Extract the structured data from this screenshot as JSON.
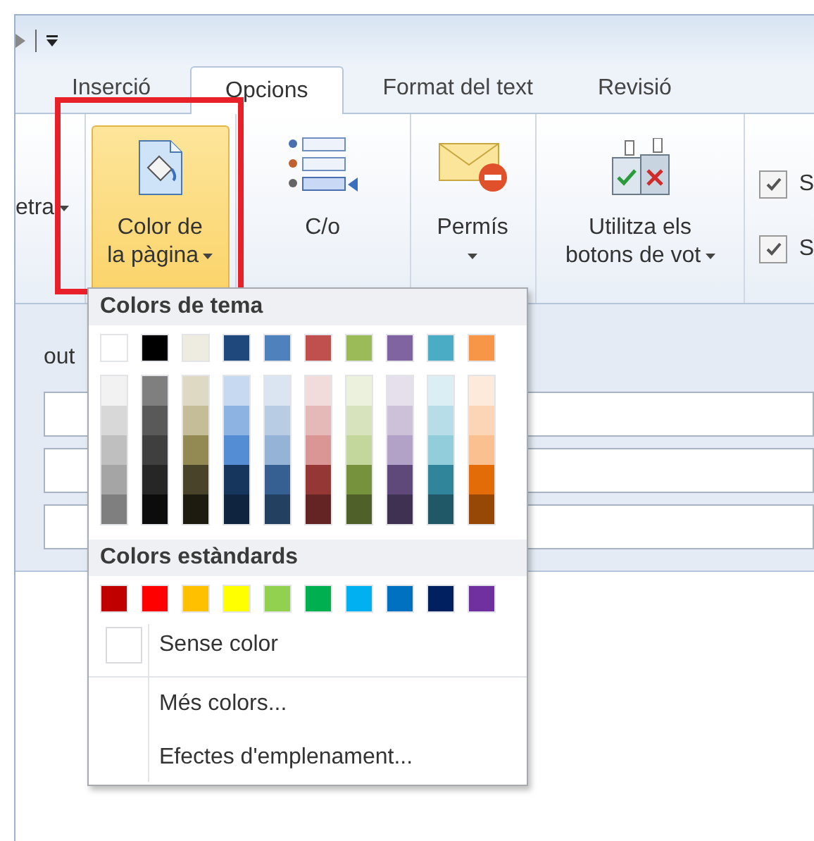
{
  "tabs": [
    {
      "label": "Inserció",
      "selected": false
    },
    {
      "label": "Opcions",
      "selected": true
    },
    {
      "label": "Format del text",
      "selected": false
    },
    {
      "label": "Revisió",
      "selected": false
    }
  ],
  "ribbon": {
    "items": [
      {
        "kind": "partial",
        "label": "etra",
        "dropdown": true
      },
      {
        "kind": "paint",
        "label": "Color de",
        "label_2": "la pàgina",
        "dropdown": true,
        "expanded": true,
        "annotated": true
      },
      {
        "kind": "cc",
        "label": "C/o",
        "dropdown": false
      },
      {
        "kind": "permission",
        "label": "Permís",
        "dropdown": true
      },
      {
        "kind": "vote",
        "label": "Utilitza els",
        "label_2": "botons de vot",
        "dropdown": true
      }
    ],
    "checkboxes": [
      {
        "label": "S",
        "checked": true
      },
      {
        "label": "S",
        "checked": true
      }
    ]
  },
  "form": {
    "label": "out"
  },
  "color_menu": {
    "theme_title": "Colors de tema",
    "theme_colors": [
      {
        "color": "#ffffff",
        "shades": [
          {
            "color": "#f2f2f2"
          },
          {
            "color": "#d8d8d8"
          },
          {
            "color": "#bfbfbf"
          },
          {
            "color": "#a5a5a5"
          },
          {
            "color": "#7f7f7f"
          }
        ]
      },
      {
        "color": "#000000",
        "shades": [
          {
            "color": "#7f7f7f"
          },
          {
            "color": "#595959"
          },
          {
            "color": "#3f3f3f"
          },
          {
            "color": "#262626"
          },
          {
            "color": "#0c0c0c"
          }
        ]
      },
      {
        "color": "#eeece1",
        "shades": [
          {
            "color": "#ddd9c3"
          },
          {
            "color": "#c4bd97"
          },
          {
            "color": "#938953"
          },
          {
            "color": "#494429"
          },
          {
            "color": "#1d1b10"
          }
        ]
      },
      {
        "color": "#1f497d",
        "shades": [
          {
            "color": "#c6d9f0"
          },
          {
            "color": "#8db3e2"
          },
          {
            "color": "#548dd4"
          },
          {
            "color": "#17365d"
          },
          {
            "color": "#0f243e"
          }
        ]
      },
      {
        "color": "#4f81bd",
        "shades": [
          {
            "color": "#dbe5f1"
          },
          {
            "color": "#b8cce4"
          },
          {
            "color": "#95b3d7"
          },
          {
            "color": "#366092"
          },
          {
            "color": "#244061"
          }
        ]
      },
      {
        "color": "#c0504d",
        "shades": [
          {
            "color": "#f2dcdb"
          },
          {
            "color": "#e5b9b7"
          },
          {
            "color": "#d99694"
          },
          {
            "color": "#953734"
          },
          {
            "color": "#632423"
          }
        ]
      },
      {
        "color": "#9bbb59",
        "shades": [
          {
            "color": "#ebf1dd"
          },
          {
            "color": "#d7e3bc"
          },
          {
            "color": "#c3d69b"
          },
          {
            "color": "#76923c"
          },
          {
            "color": "#4f6128"
          }
        ]
      },
      {
        "color": "#8064a2",
        "shades": [
          {
            "color": "#e5e0ec"
          },
          {
            "color": "#ccc1d9"
          },
          {
            "color": "#b2a2c7"
          },
          {
            "color": "#5f497a"
          },
          {
            "color": "#3f3151"
          }
        ]
      },
      {
        "color": "#4bacc6",
        "shades": [
          {
            "color": "#dbeef3"
          },
          {
            "color": "#b7dde8"
          },
          {
            "color": "#92cddc"
          },
          {
            "color": "#31859b"
          },
          {
            "color": "#205867"
          }
        ]
      },
      {
        "color": "#f79646",
        "shades": [
          {
            "color": "#fdeada"
          },
          {
            "color": "#fbd5b5"
          },
          {
            "color": "#fac08f"
          },
          {
            "color": "#e36c09"
          },
          {
            "color": "#974806"
          }
        ]
      }
    ],
    "standard_title": "Colors estàndards",
    "standard_colors": [
      {
        "color": "#c00000"
      },
      {
        "color": "#ff0000"
      },
      {
        "color": "#ffc000"
      },
      {
        "color": "#ffff00"
      },
      {
        "color": "#92d050"
      },
      {
        "color": "#00b050"
      },
      {
        "color": "#00b0f0"
      },
      {
        "color": "#0070c0"
      },
      {
        "color": "#002060"
      },
      {
        "color": "#7030a0"
      }
    ],
    "items": [
      {
        "kind": "swatch",
        "label": "Sense color"
      },
      {
        "kind": "plain",
        "label": "Més colors..."
      },
      {
        "kind": "plain",
        "label": "Efectes d'emplenament..."
      }
    ]
  }
}
